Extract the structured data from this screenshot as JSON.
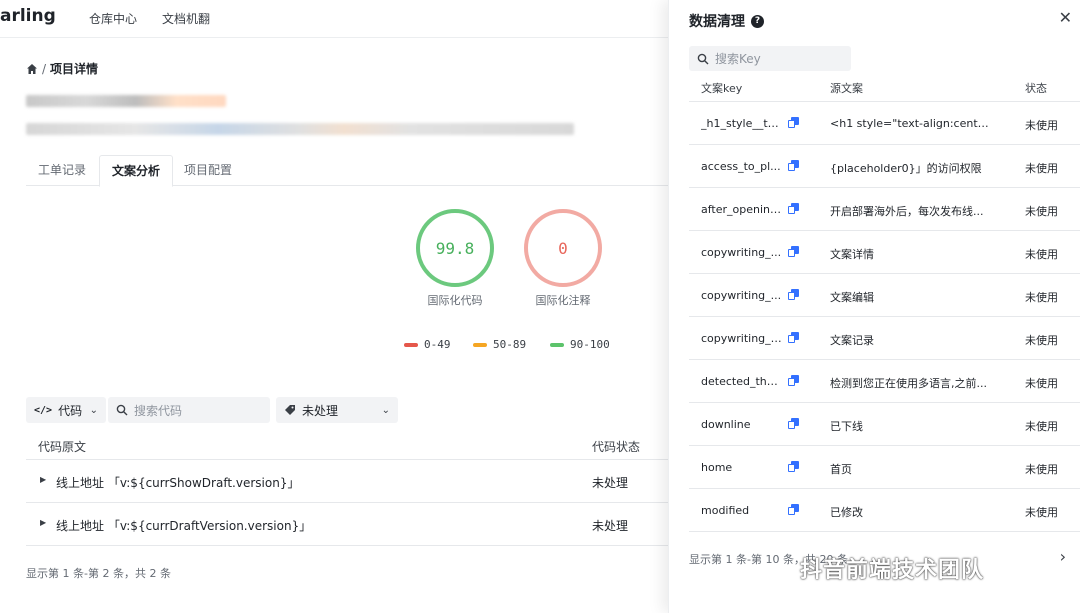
{
  "nav": {
    "brand": "arling",
    "links": [
      "仓库中心",
      "文档机翻"
    ]
  },
  "breadcrumb": {
    "separator": "/",
    "current": "项目详情"
  },
  "tabs": [
    "工单记录",
    "文案分析",
    "项目配置"
  ],
  "active_tab": "文案分析",
  "gauges": [
    {
      "value": "99.8",
      "label": "国际化代码",
      "color": "#6cc97e"
    },
    {
      "value": "0",
      "label": "国际化注释",
      "color": "#f2aaa3"
    }
  ],
  "legend": [
    {
      "label": "0-49",
      "color": "#e5574b"
    },
    {
      "label": "50-89",
      "color": "#f5a623"
    },
    {
      "label": "90-100",
      "color": "#5cc36b"
    }
  ],
  "filters": {
    "code_type": "代码",
    "search_placeholder": "搜索代码",
    "status": "未处理"
  },
  "code_table": {
    "headers": [
      "代码原文",
      "代码状态"
    ],
    "rows": [
      {
        "text": "线上地址 「v:${currShowDraft.version}」",
        "status": "未处理"
      },
      {
        "text": "线上地址 「v:${currDraftVersion.version}」",
        "status": "未处理"
      }
    ],
    "pager": "显示第 1 条-第 2 条，共 2 条"
  },
  "drawer": {
    "title": "数据清理",
    "search_placeholder": "搜索Key",
    "headers": [
      "文案key",
      "源文案",
      "状态"
    ],
    "rows": [
      {
        "key": "_h1_style__tex...",
        "source": "<h1 style=\"text-align:center;...",
        "status": "未使用"
      },
      {
        "key": "access_to_pl...",
        "source": "{placeholder0}」的访问权限",
        "status": "未使用"
      },
      {
        "key": "after_opening...",
        "source": "开启部署海外后，每次发布线...",
        "status": "未使用"
      },
      {
        "key": "copywriting_...",
        "source": "文案详情",
        "status": "未使用"
      },
      {
        "key": "copywriting_...",
        "source": "文案编辑",
        "status": "未使用"
      },
      {
        "key": "copywriting_r...",
        "source": "文案记录",
        "status": "未使用"
      },
      {
        "key": "detected_tha...",
        "source": "检测到您正在使用多语言,之前...",
        "status": "未使用"
      },
      {
        "key": "downline",
        "source": "已下线",
        "status": "未使用"
      },
      {
        "key": "home",
        "source": "首页",
        "status": "未使用"
      },
      {
        "key": "modified",
        "source": "已修改",
        "status": "未使用"
      }
    ],
    "pager": "显示第 1 条-第 10 条，共 20 条"
  },
  "watermark": "抖音前端技术团队"
}
